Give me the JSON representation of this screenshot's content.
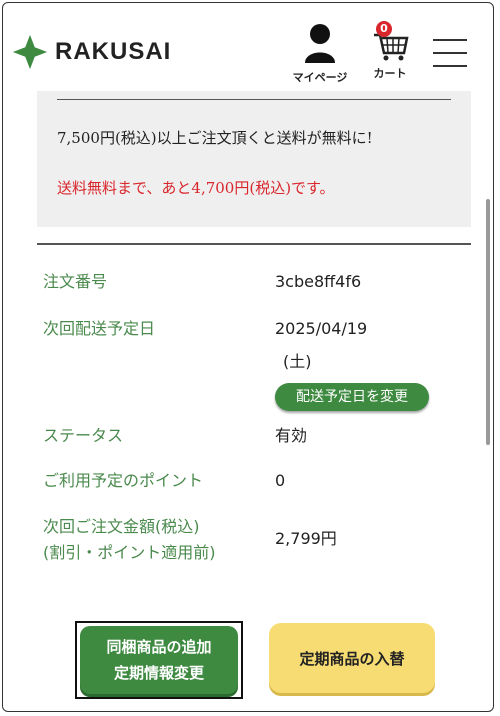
{
  "header": {
    "logo_text": "RAKUSAI",
    "mypage_label": "マイページ",
    "cart_label": "カート",
    "cart_count": "0",
    "brand_color": "#3d8a40"
  },
  "notice": {
    "line1": "7,500円(税込)以上ご注文頂くと送料が無料に!",
    "line2": "送料無料まで、あと4,700円(税込)です。"
  },
  "details": {
    "order_number_label": "注文番号",
    "order_number_value": "3cbe8ff4f6",
    "next_delivery_label": "次回配送予定日",
    "next_delivery_value": "2025/04/19",
    "next_delivery_weekday": "(土)",
    "change_date_button": "配送予定日を変更",
    "status_label": "ステータス",
    "status_value": "有効",
    "points_label": "ご利用予定のポイント",
    "points_value": "0",
    "amount_label_line1": "次回ご注文金額(税込)",
    "amount_label_line2": "(割引・ポイント適用前)",
    "amount_value": "2,799円"
  },
  "buttons": {
    "add_item_line1": "同梱商品の追加",
    "add_item_line2": "定期情報変更",
    "swap_item": "定期商品の入替"
  }
}
